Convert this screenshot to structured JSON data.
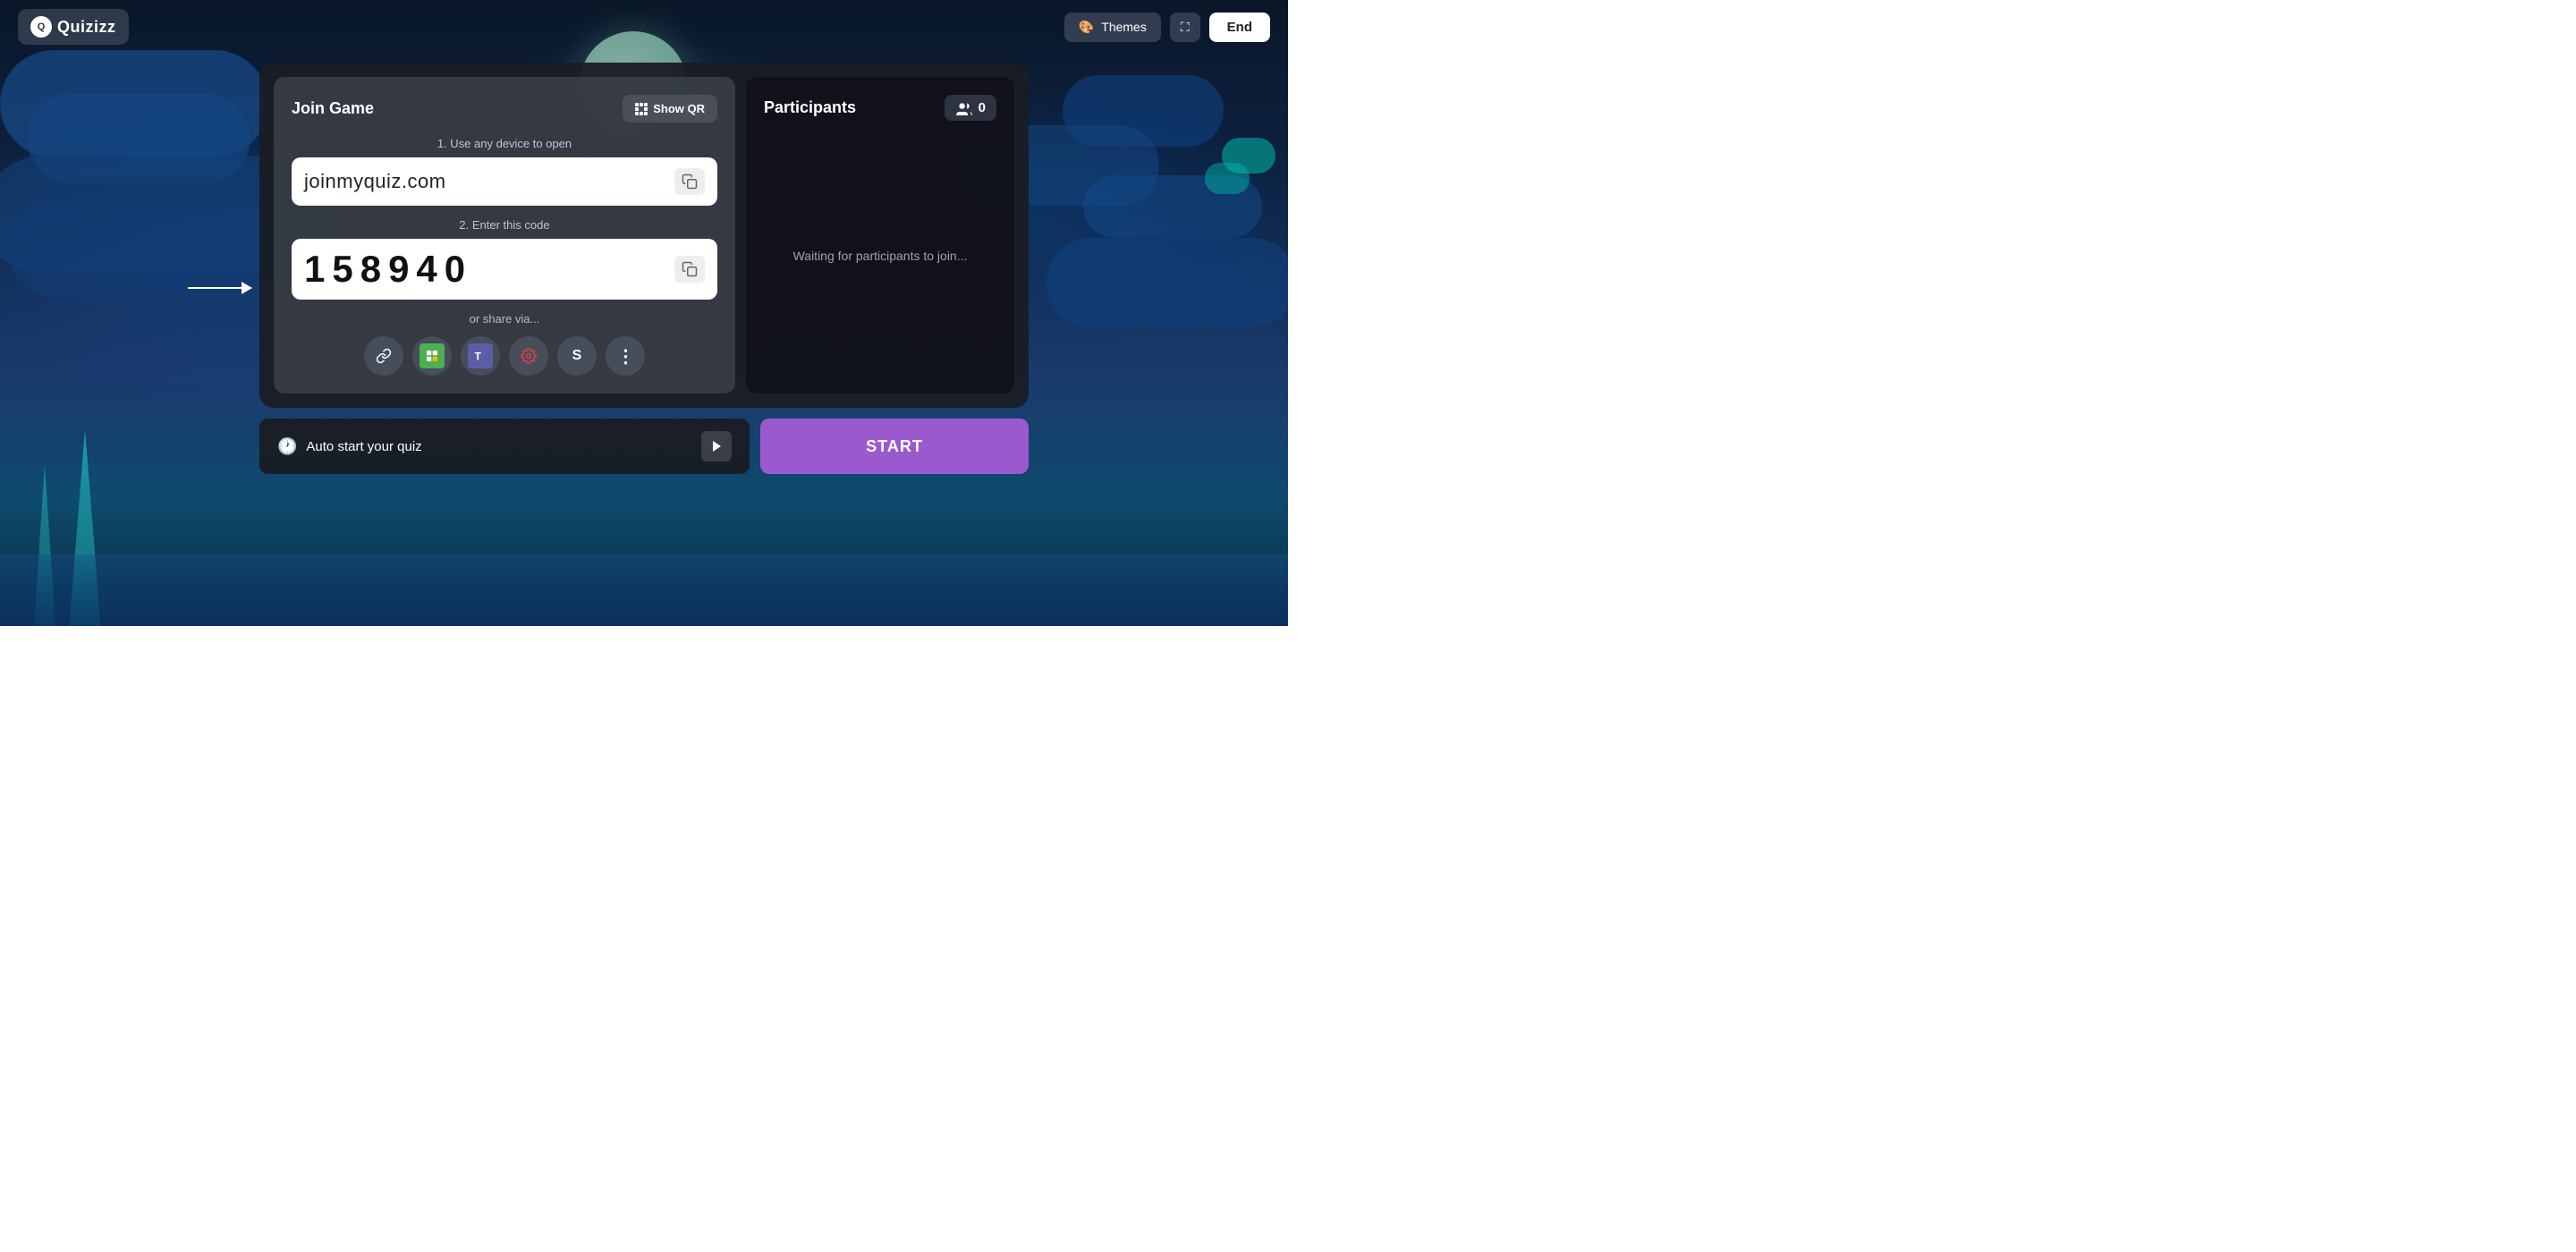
{
  "app": {
    "logo_text": "Quizizz"
  },
  "topbar": {
    "themes_label": "Themes",
    "end_label": "End"
  },
  "join_panel": {
    "title": "Join Game",
    "show_qr_label": "Show QR",
    "step1_label": "1. Use any device to open",
    "url": "joinmyquiz.com",
    "step2_label": "2. Enter this code",
    "code": "158940",
    "share_label": "or share via..."
  },
  "participants_panel": {
    "title": "Participants",
    "count": "0",
    "waiting_text": "Waiting for participants to join..."
  },
  "bottom": {
    "auto_start_label": "Auto start your quiz",
    "start_label": "START"
  },
  "share_icons": [
    {
      "name": "link",
      "symbol": "🔗"
    },
    {
      "name": "google-classroom",
      "symbol": "GC"
    },
    {
      "name": "teams",
      "symbol": "T"
    },
    {
      "name": "settings",
      "symbol": "⚙"
    },
    {
      "name": "skype",
      "symbol": "S"
    },
    {
      "name": "more",
      "symbol": "⋮"
    }
  ]
}
